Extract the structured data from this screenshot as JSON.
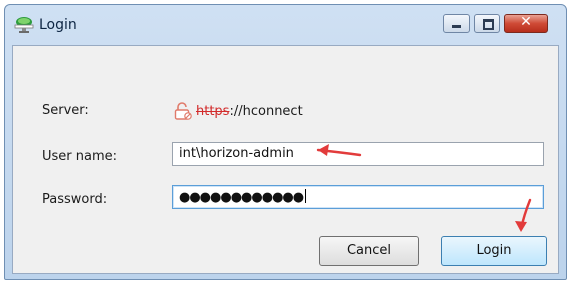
{
  "window": {
    "title": "Login",
    "icon": "cloud-monitor-icon",
    "controls": {
      "minimize": "minimize-icon",
      "maximize": "maximize-icon",
      "close_glyph": "✕"
    }
  },
  "form": {
    "server": {
      "label": "Server:",
      "scheme": "https",
      "rest": "://hconnect",
      "icon": "broken-lock-icon"
    },
    "username": {
      "label": "User name:",
      "value": "int\\horizon-admin"
    },
    "password": {
      "label": "Password:",
      "masked_value": "●●●●●●●●●●●●"
    }
  },
  "buttons": {
    "cancel": "Cancel",
    "login": "Login"
  },
  "colors": {
    "annotation_arrow": "#e23b3b",
    "insecure_scheme": "#d22b2b",
    "focus_border": "#5b9ed8"
  }
}
